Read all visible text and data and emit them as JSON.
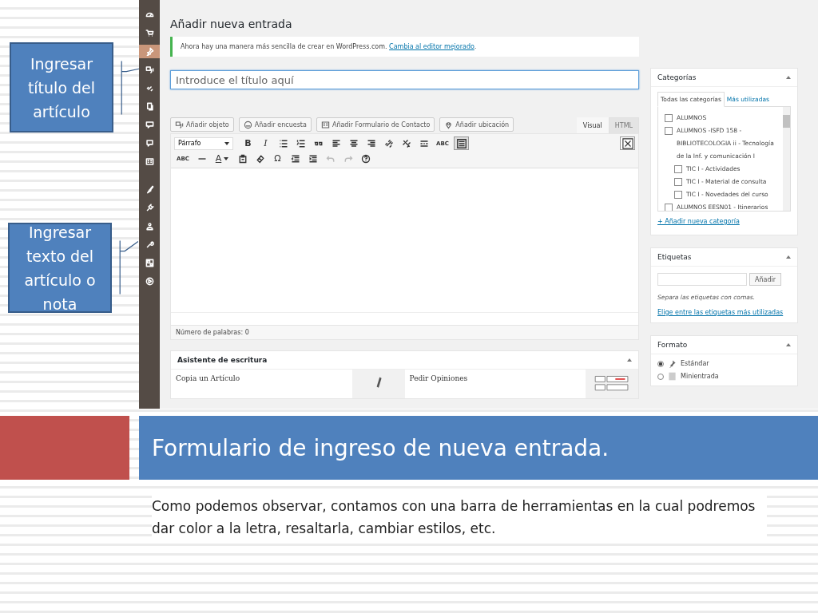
{
  "callouts": [
    {
      "text": "Ingresar título del artículo"
    },
    {
      "text": "Ingresar texto del artículo o nota"
    }
  ],
  "screenshot": {
    "admin_menu": [
      {
        "kind": "gauge",
        "selected": false
      },
      {
        "kind": "cart",
        "selected": false
      },
      {
        "kind": "pin",
        "selected": true
      },
      {
        "kind": "media",
        "selected": false
      },
      {
        "kind": "link",
        "selected": false
      },
      {
        "kind": "pages",
        "selected": false
      },
      {
        "kind": "comment",
        "selected": false
      },
      {
        "kind": "bubble",
        "selected": false
      },
      {
        "kind": "form",
        "selected": false
      },
      {
        "kind": "brush",
        "selected": false
      },
      {
        "kind": "plug",
        "selected": false
      },
      {
        "kind": "user",
        "selected": false
      },
      {
        "kind": "wrench",
        "selected": false
      },
      {
        "kind": "grid",
        "selected": false
      },
      {
        "kind": "play",
        "selected": false
      }
    ],
    "heading": "Añadir nueva entrada",
    "notice": {
      "text": "Ahora hay una manera más sencilla de crear en WordPress.com.",
      "link": "Cambia al editor mejorado",
      "end": "."
    },
    "title_field": {
      "placeholder": "Introduce el título aquí"
    },
    "media_buttons": [
      {
        "kind": "media",
        "label": "Añadir objeto"
      },
      {
        "kind": "poll",
        "label": "Añadir encuesta"
      },
      {
        "kind": "form",
        "label": "Añadir Formulario de Contacto"
      },
      {
        "kind": "location",
        "label": "Añadir ubicación"
      }
    ],
    "editor_tabs": [
      {
        "label": "Visual",
        "selected": true
      },
      {
        "label": "HTML",
        "selected": false
      }
    ],
    "format_select": {
      "value": "Párrafo"
    },
    "toolbar_rows": [
      [
        {
          "kind": "bold",
          "label": "B"
        },
        {
          "kind": "italic",
          "label": "I"
        },
        {
          "kind": "bullets"
        },
        {
          "kind": "numbers"
        },
        {
          "kind": "quote"
        },
        {
          "kind": "align-left"
        },
        {
          "kind": "align-center"
        },
        {
          "kind": "align-right"
        },
        {
          "kind": "link"
        },
        {
          "kind": "unlink"
        },
        {
          "kind": "more"
        },
        {
          "kind": "spell",
          "label": "ABC"
        },
        {
          "kind": "kitchen"
        }
      ],
      [
        {
          "kind": "strike",
          "label": "ABC"
        },
        {
          "kind": "hr"
        },
        {
          "kind": "color",
          "label": "A"
        },
        {
          "kind": "paste"
        },
        {
          "kind": "eraser"
        },
        {
          "kind": "omega",
          "label": "Ω"
        },
        {
          "kind": "outdent"
        },
        {
          "kind": "indent"
        },
        {
          "kind": "undo"
        },
        {
          "kind": "redo"
        },
        {
          "kind": "help"
        }
      ]
    ],
    "word_count": "Número de palabras: 0",
    "assistant": {
      "title": "Asistente de escritura",
      "cards": [
        {
          "kind": "pen",
          "title": "Copia un Artículo"
        },
        {
          "kind": "chart",
          "title": "Pedir Opiniones"
        }
      ]
    },
    "categories": {
      "title": "Categorías",
      "tabs": [
        {
          "label": "Todas las categorías",
          "selected": true
        },
        {
          "label": "Más utilizadas",
          "selected": false
        }
      ],
      "items": [
        {
          "label": "ALUMNOS",
          "checked": false
        },
        {
          "label": "ALUMNOS -ISFD 158 -BIBLIOTECOLOGIA ii - Tecnología de la Inf. y comunicación I",
          "checked": false,
          "children": [
            {
              "label": "TIC I - Actividades",
              "checked": false
            },
            {
              "label": "TIC I - Material de consulta",
              "checked": false
            },
            {
              "label": "TIC I - Novedades del curso",
              "checked": false
            }
          ]
        },
        {
          "label": "ALUMNOS EESN01 - Itinerarios",
          "checked": false
        }
      ],
      "add_link": "+ Añadir nueva categoría"
    },
    "tags": {
      "title": "Etiquetas",
      "button": "Añadir",
      "hint": "Separa las etiquetas con comas.",
      "link": "Elige entre las etiquetas más utilizadas"
    },
    "format": {
      "title": "Formato",
      "options": [
        {
          "kind": "pin",
          "label": "Estándar",
          "selected": true
        },
        {
          "kind": "note",
          "label": "Minientrada",
          "selected": false
        }
      ]
    }
  },
  "slide_title": "Formulario de ingreso de nueva entrada.",
  "slide_body": "Como podemos observar, contamos con una barra de herramientas en la cual podremos dar color a la letra, resaltarla, cambiar estilos, etc."
}
